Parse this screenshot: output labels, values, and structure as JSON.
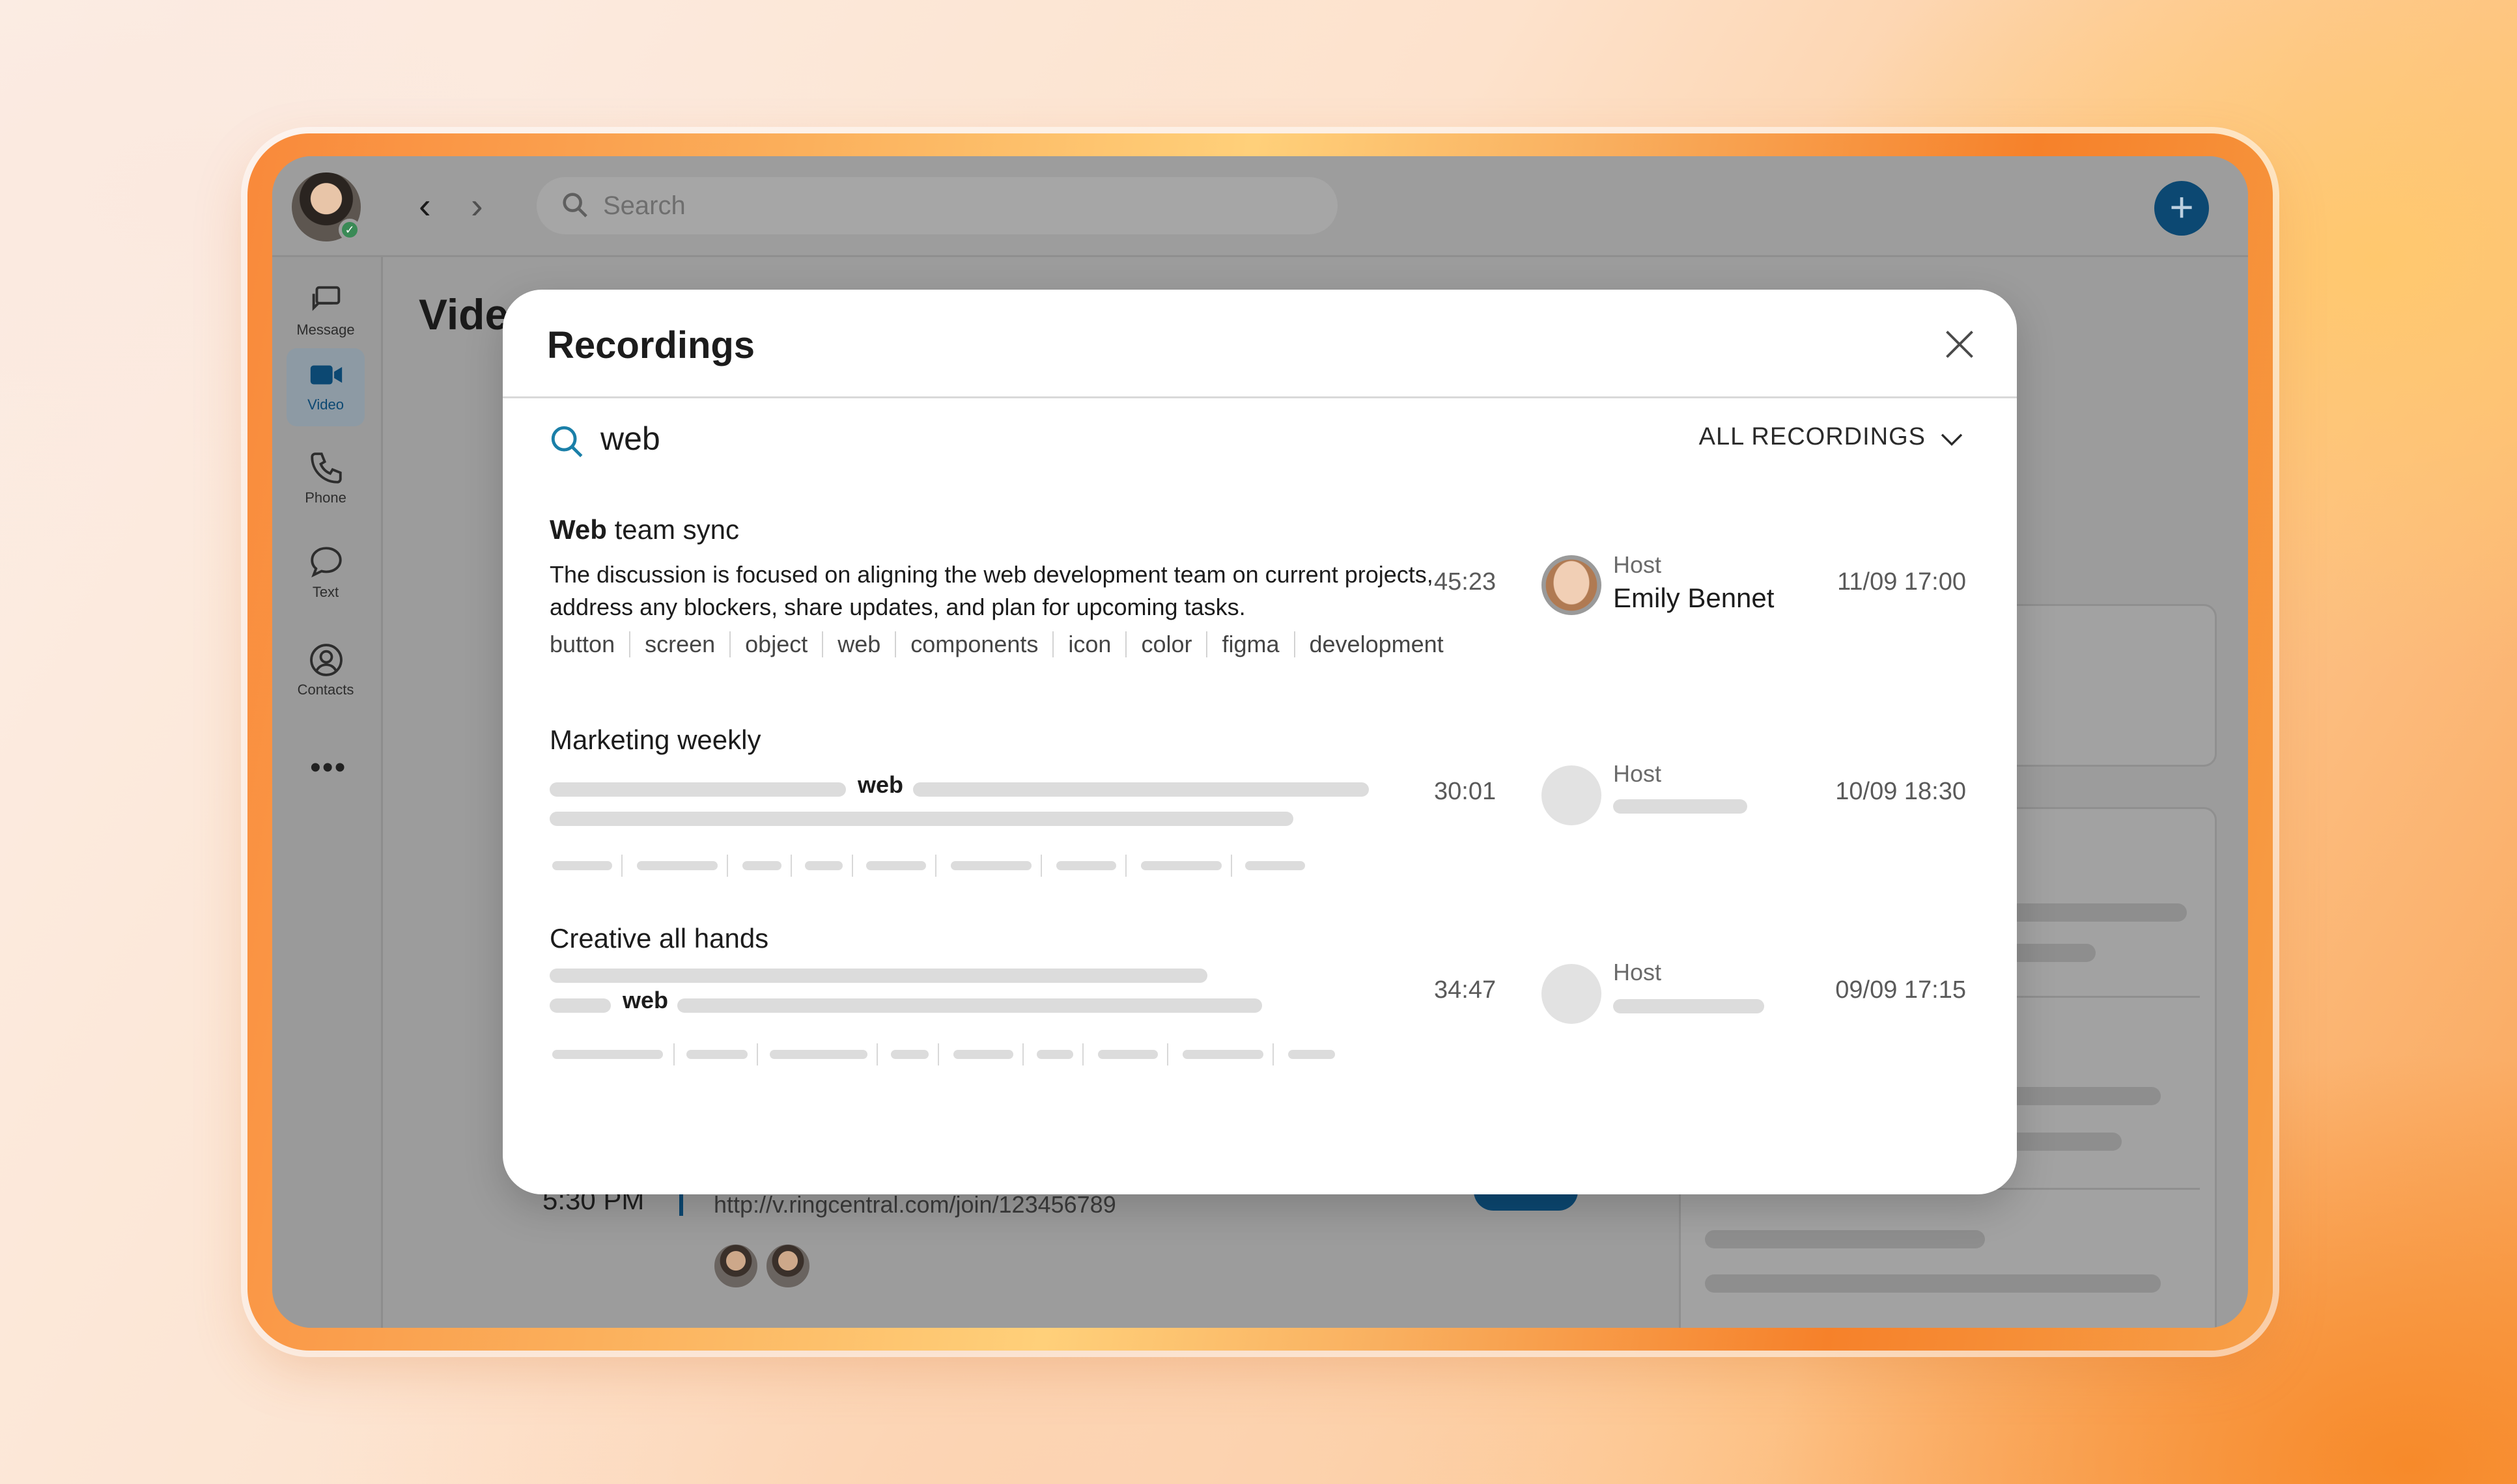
{
  "app": {
    "search_placeholder": "Search",
    "nav": [
      {
        "label": "Message",
        "icon": "message-icon"
      },
      {
        "label": "Video",
        "icon": "video-icon",
        "active": true
      },
      {
        "label": "Phone",
        "icon": "phone-icon"
      },
      {
        "label": "Text",
        "icon": "text-icon"
      },
      {
        "label": "Contacts",
        "icon": "contacts-icon"
      }
    ],
    "more_label": "•••",
    "page_title": "Vide",
    "background_meeting": {
      "time": "5:30 PM",
      "link": "http://v.ringcentral.com/join/123456789"
    },
    "colors": {
      "accent": "#0c4872",
      "search_icon": "#1a7fa8"
    }
  },
  "modal": {
    "title": "Recordings",
    "query": "web",
    "filter_label": "ALL RECORDINGS",
    "host_label": "Host",
    "recordings": [
      {
        "title_highlight": "Web",
        "title_rest": " team sync",
        "description": "The discussion is focused on aligning the web development team on current projects, address any blockers, share updates, and plan for upcoming tasks.",
        "tags": [
          "button",
          "screen",
          "object",
          "web",
          "components",
          "icon",
          "color",
          "figma",
          "development"
        ],
        "duration": "45:23",
        "host": "Emily Bennet",
        "date": "11/09 17:00"
      },
      {
        "title": "Marketing weekly",
        "snippet_highlight": "web",
        "duration": "30:01",
        "date": "10/09 18:30"
      },
      {
        "title": "Creative all hands",
        "snippet_highlight": "web",
        "duration": "34:47",
        "date": "09/09 17:15"
      }
    ]
  }
}
